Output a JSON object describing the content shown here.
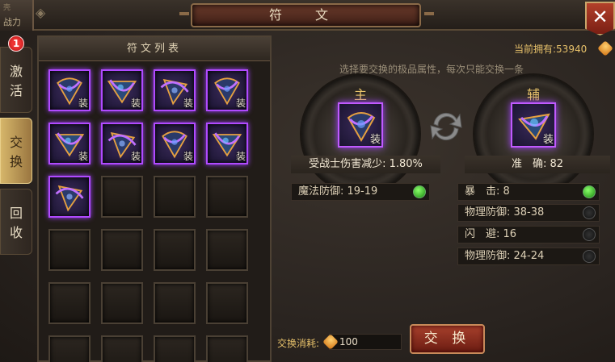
{
  "window": {
    "title": "符 文",
    "top_left_tab": "战力",
    "top_left_small": "壳",
    "close_label": "✕"
  },
  "side_tabs": [
    {
      "label": "激活",
      "badge": "1",
      "active": false
    },
    {
      "label": "交换",
      "active": true
    },
    {
      "label": "回收",
      "active": false
    }
  ],
  "rune_list": {
    "header": "符文列表",
    "equip_tag": "装",
    "filled_count": 9,
    "total_slots": 24
  },
  "owned": {
    "label": "当前拥有:",
    "value": "53940"
  },
  "instruction": "选择要交换的极品属性，每次只能交换一条",
  "main_rune": {
    "label": "主",
    "tag": "装",
    "attribute": "受战士伤害减少: 1.80%"
  },
  "secondary_rune": {
    "label": "辅",
    "tag": "装",
    "attribute": "准　确: 82"
  },
  "main_attrs": [
    {
      "text": "魔法防御: 19-19",
      "selected": true
    }
  ],
  "secondary_attrs": [
    {
      "text": "暴　击: 8",
      "selected": true
    },
    {
      "text": "物理防御: 38-38",
      "selected": false
    },
    {
      "text": "闪　避: 16",
      "selected": false
    },
    {
      "text": "物理防御: 24-24",
      "selected": false
    }
  ],
  "cost": {
    "label": "交换消耗:",
    "value": "100"
  },
  "exchange_button": "交 换",
  "colors": {
    "accent_purple": "#b04aff",
    "gold": "#e6c06a",
    "button_red": "#a8402c"
  }
}
